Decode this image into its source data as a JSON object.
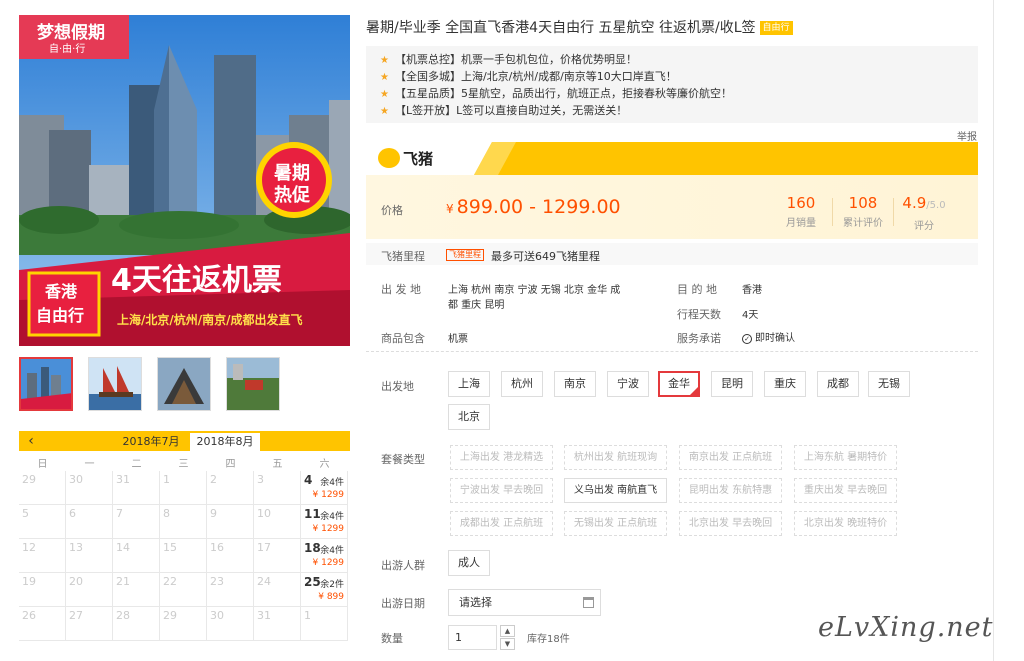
{
  "product": {
    "title": "暑期/毕业季 全国直飞香港4天自由行 五星航空 往返机票/收L签",
    "title_tag": "自由行",
    "highlights": [
      "【机票总控】机票一手包机包位，价格优势明显！",
      "【全国多城】上海/北京/杭州/成都/南京等10大口岸直飞！",
      "【五星品质】5星航空，品质出行，航班正点，拒接春秋等廉价航空！",
      "【L签开放】L签可以直接自助过关，无需送关！"
    ],
    "report_label": "举报"
  },
  "hero": {
    "badge_title": "梦想假期",
    "badge_sub": "自·由·行",
    "promo_line1": "暑期",
    "promo_line2": "热促",
    "tag_line1": "香港",
    "tag_line2": "自由行",
    "main_slogan": "4天往返机票",
    "sub_slogan": "上海/北京/杭州/南京/成都出发直飞"
  },
  "brand": {
    "name": "飞猪"
  },
  "price": {
    "label": "价格",
    "currency": "¥",
    "range": "899.00 - 1299.00",
    "stats": [
      {
        "value": "160",
        "sub": "",
        "label": "月销量"
      },
      {
        "value": "108",
        "sub": "",
        "label": "累计评价"
      },
      {
        "value": "4.9",
        "sub": "/5.0",
        "label": "评分"
      }
    ]
  },
  "mileage": {
    "label": "飞猪里程",
    "tag": "飞猪里程",
    "text": "最多可送649飞猪里程"
  },
  "info": {
    "departure_label": "出 发 地",
    "departure_line1": "上海  杭州  南京  宁波  无锡  北京  金华  成",
    "departure_line2": "都  重庆  昆明",
    "destination_label": "目 的 地",
    "destination_value": "香港",
    "days_label": "行程天数",
    "days_value": "4天",
    "includes_label": "商品包含",
    "includes_value": "机票",
    "service_label": "服务承诺",
    "service_value": "即时确认"
  },
  "selectors": {
    "departure_label": "出发地",
    "departure_options": [
      "上海",
      "杭州",
      "南京",
      "宁波",
      "金华",
      "昆明",
      "重庆",
      "成都",
      "无锡",
      "北京"
    ],
    "departure_selected": "金华",
    "package_label": "套餐类型",
    "package_options": [
      "上海出发 港龙精选",
      "杭州出发 航班现询",
      "南京出发 正点航班",
      "上海东航 暑期特价",
      "宁波出发 早去晚回",
      "义乌出发 南航直飞",
      "昆明出发 东航特惠",
      "重庆出发 早去晚回",
      "成都出发 正点航班",
      "无锡出发 正点航班",
      "北京出发 早去晚回",
      "北京出发 晚班特价"
    ],
    "package_enabled": "义乌出发 南航直飞",
    "group_label": "出游人群",
    "group_option": "成人",
    "date_label": "出游日期",
    "date_placeholder": "请选择",
    "qty_label": "数量",
    "qty_value": "1",
    "stock_text": "库存18件"
  },
  "calendar": {
    "tabs": [
      "2018年7月",
      "2018年8月"
    ],
    "active_tab": "2018年8月",
    "weekdays": [
      "日",
      "一",
      "二",
      "三",
      "四",
      "五",
      "六"
    ],
    "weeks": [
      [
        {
          "d": "29"
        },
        {
          "d": "30"
        },
        {
          "d": "31"
        },
        {
          "d": "1"
        },
        {
          "d": "2"
        },
        {
          "d": "3"
        },
        {
          "d": "4",
          "stock": "余4件",
          "price": "¥ 1299"
        }
      ],
      [
        {
          "d": "5"
        },
        {
          "d": "6"
        },
        {
          "d": "7"
        },
        {
          "d": "8"
        },
        {
          "d": "9"
        },
        {
          "d": "10"
        },
        {
          "d": "11",
          "stock": "余4件",
          "price": "¥ 1299"
        }
      ],
      [
        {
          "d": "12"
        },
        {
          "d": "13"
        },
        {
          "d": "14"
        },
        {
          "d": "15"
        },
        {
          "d": "16"
        },
        {
          "d": "17"
        },
        {
          "d": "18",
          "stock": "余4件",
          "price": "¥ 1299"
        }
      ],
      [
        {
          "d": "19"
        },
        {
          "d": "20"
        },
        {
          "d": "21"
        },
        {
          "d": "22"
        },
        {
          "d": "23"
        },
        {
          "d": "24"
        },
        {
          "d": "25",
          "stock": "余2件",
          "price": "¥ 899"
        }
      ],
      [
        {
          "d": "26"
        },
        {
          "d": "27"
        },
        {
          "d": "28"
        },
        {
          "d": "29"
        },
        {
          "d": "30"
        },
        {
          "d": "31"
        },
        {
          "d": "1"
        }
      ]
    ]
  },
  "watermark": "eLvXing.net",
  "colors": {
    "accent": "#ff5000",
    "brand_yellow": "#ffc400",
    "selected_border": "#e4393c"
  }
}
